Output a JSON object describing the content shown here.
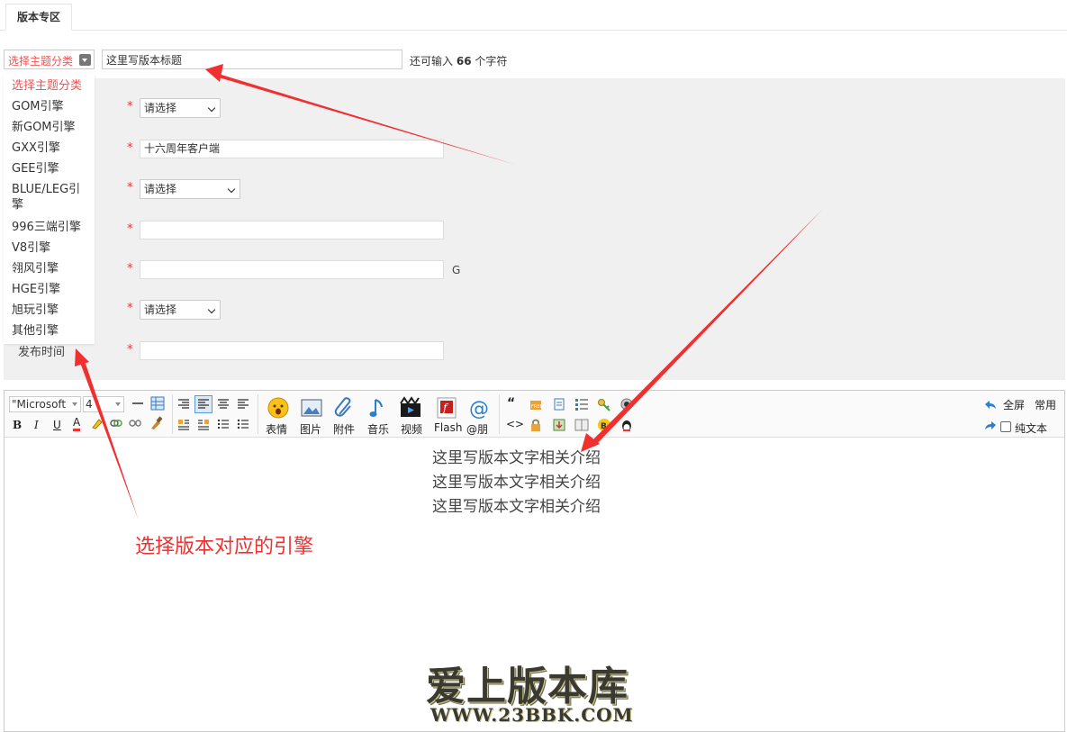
{
  "tab": {
    "label": "版本专区"
  },
  "title_row": {
    "category_value": "选择主题分类",
    "title_value": "这里写版本标题",
    "counter_prefix": "还可输入",
    "counter_number": "66",
    "counter_suffix": "个字符"
  },
  "dropdown": {
    "options": [
      "选择主题分类",
      "GOM引擎",
      "新GOM引擎",
      "GXX引擎",
      "GEE引擎",
      "BLUE/LEG引擎",
      "996三端引擎",
      "V8引擎",
      "翎风引擎",
      "HGE引擎",
      "旭玩引擎",
      "其他引擎"
    ]
  },
  "form": {
    "select1": "请选择",
    "text1": "十六周年客户端",
    "select2": "请选择",
    "unit_g": "G",
    "select3": "请选择",
    "release_label": "发布时间",
    "required_mark": "*"
  },
  "toolbar": {
    "font_family": "\"Microsoft",
    "font_size": "4",
    "bold": "B",
    "italic": "I",
    "underline": "U",
    "font_color": "A",
    "emoji_label": "表情",
    "image_label": "图片",
    "attach_label": "附件",
    "music_label": "音乐",
    "video_label": "视频",
    "flash_label": "Flash",
    "at_label": "@朋",
    "quote_glyph": "“",
    "code_glyph": "<>",
    "fullscreen_label": "全屏",
    "common_label": "常用",
    "plaintext_label": "纯文本"
  },
  "editor": {
    "lines": [
      "这里写版本文字相关介绍",
      "这里写版本文字相关介绍",
      "这里写版本文字相关介绍"
    ]
  },
  "annotation": {
    "text": "选择版本对应的引擎"
  },
  "watermark": {
    "cn": "爱上版本库",
    "en": "WWW.23BBK.COM"
  },
  "colors": {
    "accent_red": "#f03030",
    "form_bg": "#f0f0f0",
    "selected_option": "#e55555"
  }
}
